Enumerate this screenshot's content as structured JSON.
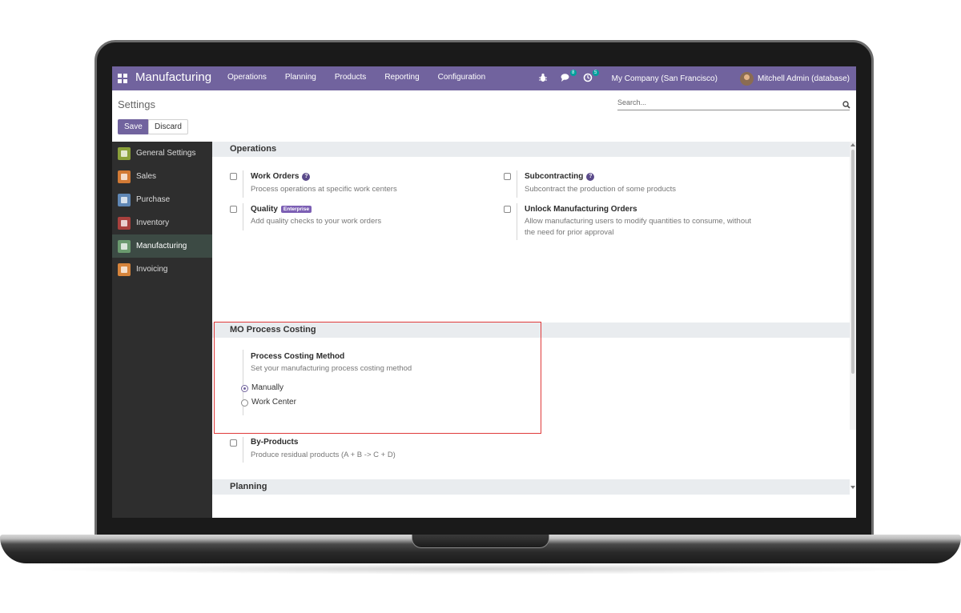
{
  "navbar": {
    "brand": "Manufacturing",
    "menu": [
      "Operations",
      "Planning",
      "Products",
      "Reporting",
      "Configuration"
    ],
    "messages_count": "8",
    "activities_count": "5",
    "company": "My Company (San Francisco)",
    "user": "Mitchell Admin (database)",
    "color": "#71639e"
  },
  "control": {
    "breadcrumb": "Settings",
    "save_label": "Save",
    "discard_label": "Discard",
    "search_placeholder": "Search..."
  },
  "sidebar": {
    "items": [
      {
        "label": "General Settings",
        "icon": "gear-icon",
        "color": "#8aa03a"
      },
      {
        "label": "Sales",
        "icon": "chart-icon",
        "color": "#d27a35"
      },
      {
        "label": "Purchase",
        "icon": "card-icon",
        "color": "#5f87b5"
      },
      {
        "label": "Inventory",
        "icon": "box-icon",
        "color": "#a8403d"
      },
      {
        "label": "Manufacturing",
        "icon": "wrench-icon",
        "color": "#6a9a6e"
      },
      {
        "label": "Invoicing",
        "icon": "invoice-icon",
        "color": "#d6843b"
      }
    ],
    "active": "Manufacturing"
  },
  "sections": {
    "operations": {
      "title": "Operations",
      "work_orders": {
        "title": "Work Orders",
        "desc": "Process operations at specific work centers"
      },
      "subcontracting": {
        "title": "Subcontracting",
        "desc": "Subcontract the production of some products"
      },
      "quality": {
        "title": "Quality",
        "badge": "Enterprise",
        "desc": "Add quality checks to your work orders"
      },
      "unlock_mo": {
        "title": "Unlock Manufacturing Orders",
        "desc_line1": "Allow manufacturing users to modify quantities to consume, without",
        "desc_line2": "the need for prior approval"
      }
    },
    "mo_costing": {
      "title": "MO Process Costing",
      "method_title": "Process Costing Method",
      "method_desc": "Set your manufacturing process costing method",
      "options": [
        "Manually",
        "Work Center"
      ],
      "selected": "Manually"
    },
    "byproducts": {
      "title": "By-Products",
      "desc": "Produce residual products (A + B -> C + D)"
    },
    "planning": {
      "title": "Planning"
    }
  },
  "highlight_color": "#e03a3a"
}
